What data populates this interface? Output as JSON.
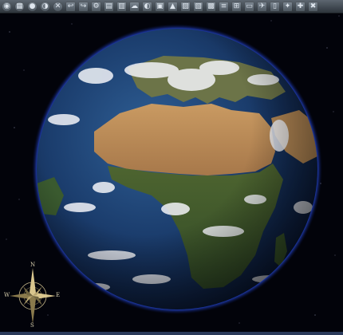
{
  "toolbar": {
    "buttons": [
      {
        "name": "globe-view-icon",
        "glyph": "◉"
      },
      {
        "name": "grid-icon",
        "glyph": "▦"
      },
      {
        "name": "earth-icon",
        "glyph": "●"
      },
      {
        "name": "moon-icon",
        "glyph": "◑"
      },
      {
        "name": "compass-tool-icon",
        "glyph": "✕"
      },
      {
        "name": "back-icon",
        "glyph": "↩"
      },
      {
        "name": "forward-icon",
        "glyph": "↪"
      },
      {
        "name": "tools-icon",
        "glyph": "⚙"
      },
      {
        "name": "print-icon",
        "glyph": "▤"
      },
      {
        "name": "layers-icon",
        "glyph": "▥"
      },
      {
        "name": "weather-icon",
        "glyph": "☁"
      },
      {
        "name": "palette-icon",
        "glyph": "◐"
      },
      {
        "name": "image-icon",
        "glyph": "▣"
      },
      {
        "name": "terrain-icon",
        "glyph": "▲"
      },
      {
        "name": "chart-icon",
        "glyph": "▨"
      },
      {
        "name": "map-icon",
        "glyph": "▧"
      },
      {
        "name": "photo-icon",
        "glyph": "▩"
      },
      {
        "name": "stack-icon",
        "glyph": "≡"
      },
      {
        "name": "measure-icon",
        "glyph": "⊞"
      },
      {
        "name": "ruler-icon",
        "glyph": "▭"
      },
      {
        "name": "plane-icon",
        "glyph": "✈"
      },
      {
        "name": "document-icon",
        "glyph": "▯"
      },
      {
        "name": "settings-icon",
        "glyph": "✦"
      },
      {
        "name": "info-icon",
        "glyph": "✚"
      },
      {
        "name": "help-icon",
        "glyph": "✖"
      }
    ]
  },
  "compass": {
    "north": "N",
    "south": "S",
    "east": "E",
    "west": "W"
  },
  "colors": {
    "ocean": "#173a6b",
    "atmosphere": "#2a49c8",
    "desert": "#b88a55",
    "vegetation": "#3f5a2b",
    "toolbar": "#3d454d"
  }
}
